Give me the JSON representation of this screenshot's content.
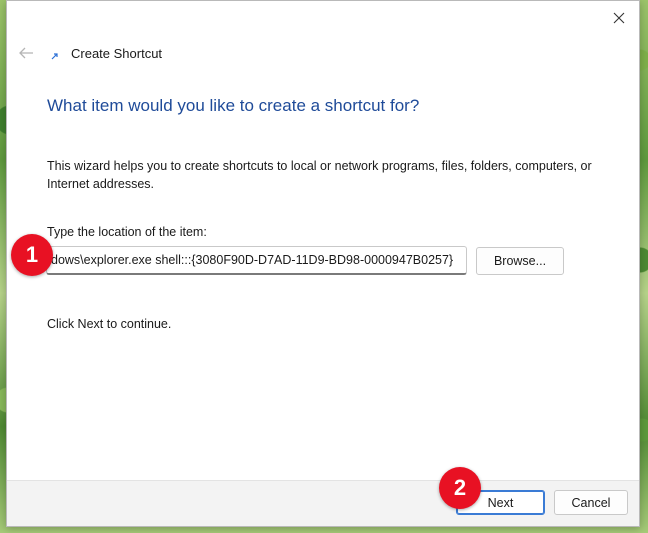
{
  "window": {
    "title": "Create Shortcut"
  },
  "main": {
    "heading": "What item would you like to create a shortcut for?",
    "description": "This wizard helps you to create shortcuts to local or network programs, files, folders, computers, or Internet addresses.",
    "location_label": "Type the location of the item:",
    "location_value": "dows\\explorer.exe shell:::{3080F90D-D7AD-11D9-BD98-0000947B0257}",
    "browse_label": "Browse...",
    "continue_text": "Click Next to continue."
  },
  "footer": {
    "next_label": "Next",
    "cancel_label": "Cancel"
  },
  "callouts": {
    "first": "1",
    "second": "2"
  },
  "colors": {
    "heading": "#1f4b99",
    "callout": "#e81123",
    "accent": "#3a7bd5"
  },
  "icons": {
    "close": "close-icon",
    "back": "back-arrow-icon",
    "shortcut": "shortcut-arrow-icon"
  }
}
